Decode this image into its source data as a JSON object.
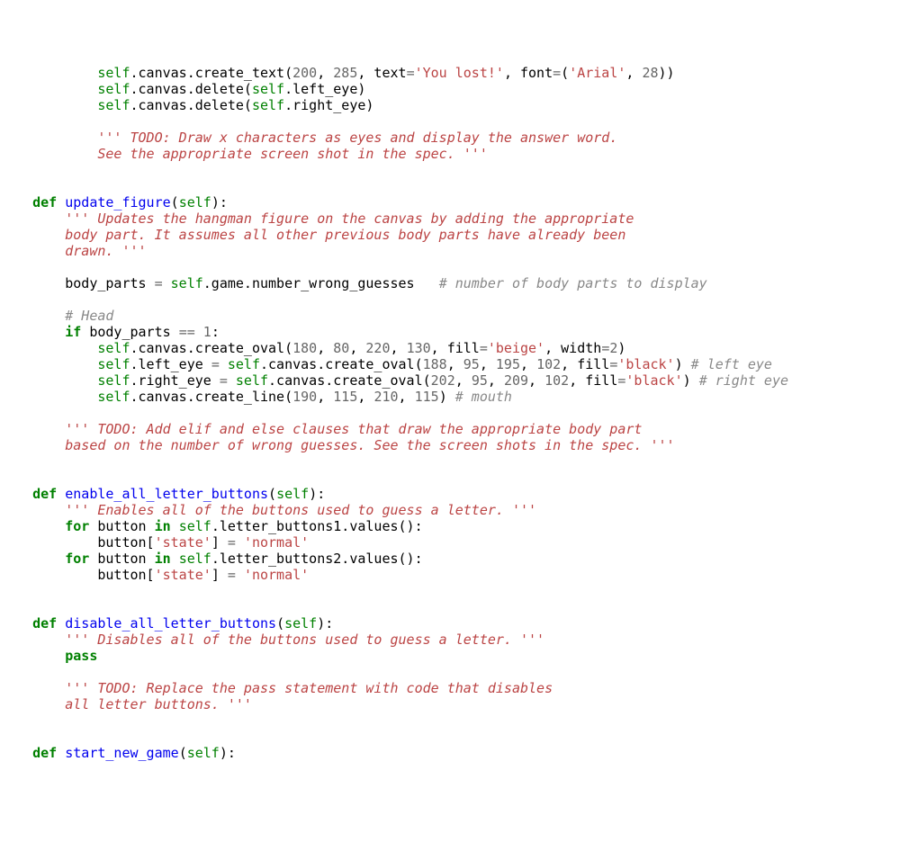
{
  "code": {
    "l01a": "            ",
    "l01b": "self",
    "l01c": ".canvas.create_text(",
    "l01d": "200",
    "l01e": ", ",
    "l01f": "285",
    "l01g": ", text",
    "l01h": "=",
    "l01i": "'You lost!'",
    "l01j": ", font",
    "l01k": "=",
    "l01l": "(",
    "l01m": "'Arial'",
    "l01n": ", ",
    "l01o": "28",
    "l01p": "))",
    "l02a": "            ",
    "l02b": "self",
    "l02c": ".canvas.delete(",
    "l02d": "self",
    "l02e": ".left_eye)",
    "l03a": "            ",
    "l03b": "self",
    "l03c": ".canvas.delete(",
    "l03d": "self",
    "l03e": ".right_eye)",
    "l05a": "            ",
    "l05b": "''' TODO: Draw x characters as eyes and display the answer word.",
    "l06a": "            See the appropriate screen shot in the spec. '''",
    "l09a": "    ",
    "l09b": "def",
    "l09c": " ",
    "l09d": "update_figure",
    "l09e": "(",
    "l09f": "self",
    "l09g": "):",
    "l10a": "        ",
    "l10b": "''' Updates the hangman figure on the canvas by adding the appropriate",
    "l11a": "        body part. It assumes all other previous body parts have already been",
    "l12a": "        drawn. '''",
    "l14a": "        body_parts ",
    "l14b": "=",
    "l14c": " ",
    "l14d": "self",
    "l14e": ".game.number_wrong_guesses   ",
    "l14f": "# number of body parts to display",
    "l16a": "        ",
    "l16b": "# Head",
    "l17a": "        ",
    "l17b": "if",
    "l17c": " body_parts ",
    "l17d": "==",
    "l17e": " ",
    "l17f": "1",
    "l17g": ":",
    "l18a": "            ",
    "l18b": "self",
    "l18c": ".canvas.create_oval(",
    "l18d": "180",
    "l18e": ", ",
    "l18f": "80",
    "l18g": ", ",
    "l18h": "220",
    "l18i": ", ",
    "l18j": "130",
    "l18k": ", fill",
    "l18l": "=",
    "l18m": "'beige'",
    "l18n": ", width",
    "l18o": "=",
    "l18p": "2",
    "l18q": ")",
    "l19a": "            ",
    "l19b": "self",
    "l19c": ".left_eye ",
    "l19d": "=",
    "l19e": " ",
    "l19f": "self",
    "l19g": ".canvas.create_oval(",
    "l19h": "188",
    "l19i": ", ",
    "l19j": "95",
    "l19k": ", ",
    "l19l": "195",
    "l19m": ", ",
    "l19n": "102",
    "l19o": ", fill",
    "l19p": "=",
    "l19q": "'black'",
    "l19r": ") ",
    "l19s": "# left eye",
    "l20a": "            ",
    "l20b": "self",
    "l20c": ".right_eye ",
    "l20d": "=",
    "l20e": " ",
    "l20f": "self",
    "l20g": ".canvas.create_oval(",
    "l20h": "202",
    "l20i": ", ",
    "l20j": "95",
    "l20k": ", ",
    "l20l": "209",
    "l20m": ", ",
    "l20n": "102",
    "l20o": ", fill",
    "l20p": "=",
    "l20q": "'black'",
    "l20r": ") ",
    "l20s": "# right eye",
    "l21a": "            ",
    "l21b": "self",
    "l21c": ".canvas.create_line(",
    "l21d": "190",
    "l21e": ", ",
    "l21f": "115",
    "l21g": ", ",
    "l21h": "210",
    "l21i": ", ",
    "l21j": "115",
    "l21k": ") ",
    "l21l": "# mouth",
    "l23a": "        ",
    "l23b": "''' TODO: Add elif and else clauses that draw the appropriate body part",
    "l24a": "        based on the number of wrong guesses. See the screen shots in the spec. '''",
    "l27a": "    ",
    "l27b": "def",
    "l27c": " ",
    "l27d": "enable_all_letter_buttons",
    "l27e": "(",
    "l27f": "self",
    "l27g": "):",
    "l28a": "        ",
    "l28b": "''' Enables all of the buttons used to guess a letter. '''",
    "l29a": "        ",
    "l29b": "for",
    "l29c": " button ",
    "l29d": "in",
    "l29e": " ",
    "l29f": "self",
    "l29g": ".letter_buttons1.values():",
    "l30a": "            button[",
    "l30b": "'state'",
    "l30c": "] ",
    "l30d": "=",
    "l30e": " ",
    "l30f": "'normal'",
    "l31a": "        ",
    "l31b": "for",
    "l31c": " button ",
    "l31d": "in",
    "l31e": " ",
    "l31f": "self",
    "l31g": ".letter_buttons2.values():",
    "l32a": "            button[",
    "l32b": "'state'",
    "l32c": "] ",
    "l32d": "=",
    "l32e": " ",
    "l32f": "'normal'",
    "l35a": "    ",
    "l35b": "def",
    "l35c": " ",
    "l35d": "disable_all_letter_buttons",
    "l35e": "(",
    "l35f": "self",
    "l35g": "):",
    "l36a": "        ",
    "l36b": "''' Disables all of the buttons used to guess a letter. '''",
    "l37a": "        ",
    "l37b": "pass",
    "l39a": "        ",
    "l39b": "''' TODO: Replace the pass statement with code that disables",
    "l40a": "        all letter buttons. '''",
    "l43a": "    ",
    "l43b": "def",
    "l43c": " ",
    "l43d": "start_new_game",
    "l43e": "(",
    "l43f": "self",
    "l43g": "):"
  }
}
